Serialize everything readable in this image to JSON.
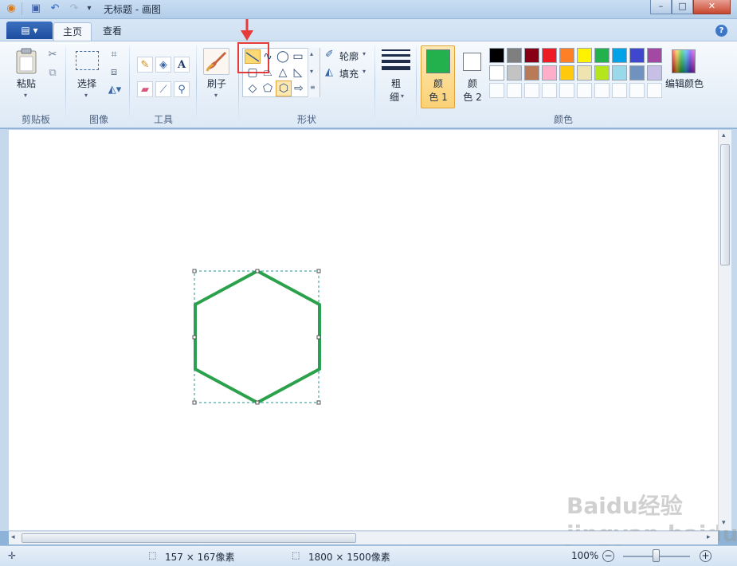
{
  "titlebar": {
    "title": "无标题 - 画图",
    "minimize": "–",
    "maximize": "□",
    "close": "✕"
  },
  "tabs": {
    "app_menu": "▤ ▾",
    "home": "主页",
    "view": "查看",
    "help": "?"
  },
  "ribbon": {
    "clipboard": {
      "paste": "粘贴",
      "group": "剪贴板"
    },
    "image": {
      "select": "选择",
      "group": "图像"
    },
    "tools": {
      "group": "工具"
    },
    "brushes": {
      "label": "刷子"
    },
    "shapes": {
      "outline": "轮廓",
      "fill": "填充",
      "group": "形状"
    },
    "size": {
      "label1": "粗",
      "label2": "细"
    },
    "colors": {
      "color1_a": "颜",
      "color1_b": "色 1",
      "color2_a": "颜",
      "color2_b": "色 2",
      "edit": "编辑颜色",
      "group": "颜色",
      "color1_value": "#22b14c",
      "color2_value": "#ffffff",
      "row1": [
        "#000000",
        "#7f7f7f",
        "#880015",
        "#ed1c24",
        "#ff7f27",
        "#fff200",
        "#22b14c",
        "#00a2e8",
        "#3f48cc",
        "#a349a4"
      ],
      "row2": [
        "#ffffff",
        "#c3c3c3",
        "#b97a57",
        "#ffaec9",
        "#ffc90e",
        "#efe4b0",
        "#b5e61d",
        "#99d9ea",
        "#7092be",
        "#c8bfe7"
      ]
    }
  },
  "canvas": {
    "shape_color": "#2aa14a"
  },
  "status": {
    "selection_size": "157 × 167像素",
    "image_size": "1800 × 1500像素",
    "zoom": "100%"
  },
  "watermark": "Baidu经验 jingyan.baidu.com"
}
